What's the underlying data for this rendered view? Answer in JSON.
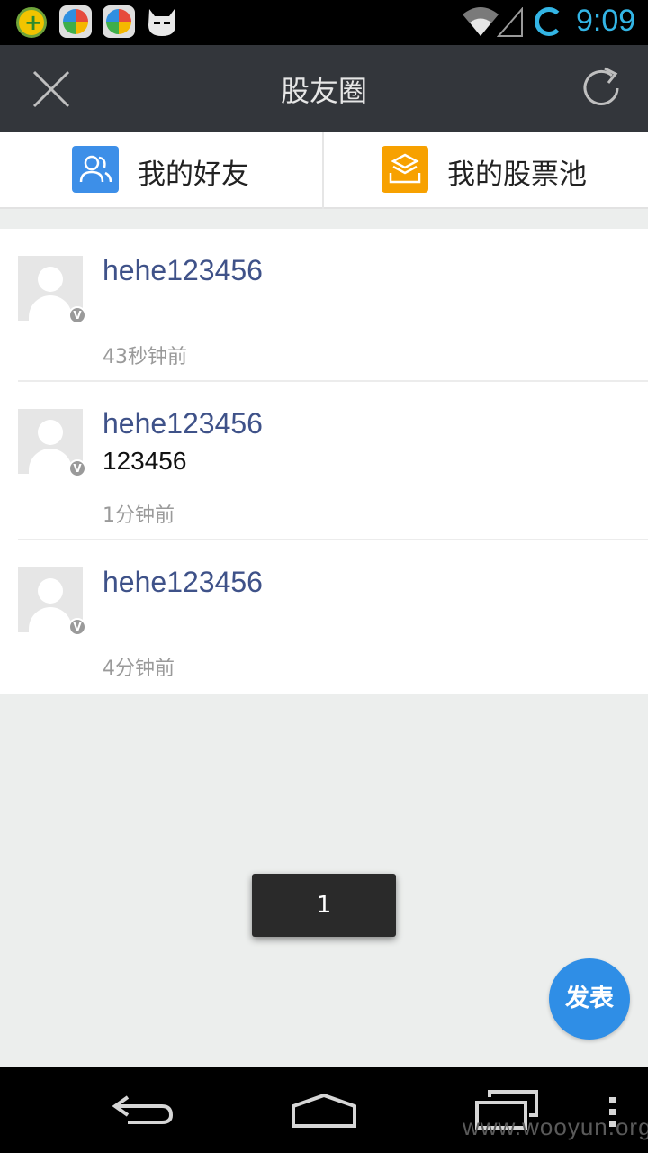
{
  "status_bar": {
    "time": "9:09",
    "icons": [
      "app-plus-icon",
      "app-store-icon",
      "app-store-icon",
      "cyanogen-cat-icon",
      "wifi-icon",
      "signal-icon",
      "sync-icon"
    ]
  },
  "header": {
    "title": "股友圈",
    "left_icon": "close-icon",
    "right_icon": "refresh-icon"
  },
  "tabs": [
    {
      "label": "我的好友",
      "icon": "friends-icon",
      "color": "#3d8fe8"
    },
    {
      "label": "我的股票池",
      "icon": "stock-pool-icon",
      "color": "#f7a100"
    }
  ],
  "posts": [
    {
      "username": "hehe123456",
      "content": "",
      "time": "43秒钟前",
      "badge": "V"
    },
    {
      "username": "hehe123456",
      "content": "123456",
      "time": "1分钟前",
      "badge": "V"
    },
    {
      "username": "hehe123456",
      "content": "",
      "time": "4分钟前",
      "badge": "V"
    }
  ],
  "toast": {
    "text": "1"
  },
  "fab": {
    "label": "发表",
    "color": "#2f8ee6"
  },
  "nav_bar": {
    "icons": [
      "back-icon",
      "home-icon",
      "recent-apps-icon",
      "menu-icon"
    ],
    "watermark": "www.wooyun.org"
  }
}
